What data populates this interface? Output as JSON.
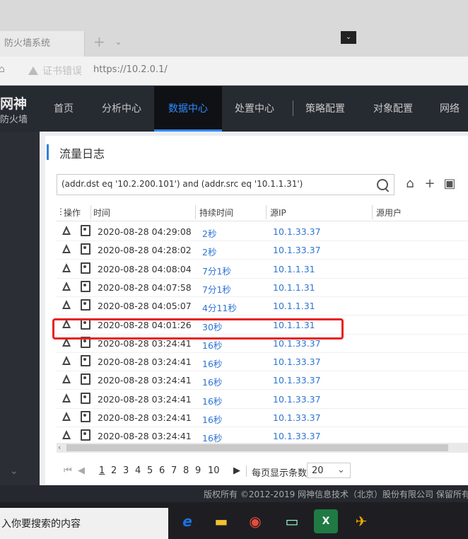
{
  "browser": {
    "tab_title": "防火墙系统",
    "cert_warning": "证书错误",
    "url": "https://10.2.0.1/"
  },
  "app": {
    "logo_line1": "网神",
    "logo_line2": "防火墙",
    "nav": [
      "首页",
      "分析中心",
      "数据中心",
      "处置中心",
      "策略配置",
      "对象配置",
      "网络配"
    ],
    "active_nav": "数据中心"
  },
  "panel": {
    "title": "流量日志",
    "search_query": "(addr.dst eq '10.2.200.101') and (addr.src eq '10.1.1.31')"
  },
  "table": {
    "headers": {
      "op": "操作",
      "time": "时间",
      "duration": "持续时间",
      "src_ip": "源IP",
      "src_user": "源用户"
    },
    "rows": [
      {
        "time": "2020-08-28 04:29:08",
        "duration": "2秒",
        "src_ip": "10.1.33.37"
      },
      {
        "time": "2020-08-28 04:28:02",
        "duration": "2秒",
        "src_ip": "10.1.33.37"
      },
      {
        "time": "2020-08-28 04:08:04",
        "duration": "7分1秒",
        "src_ip": "10.1.1.31"
      },
      {
        "time": "2020-08-28 04:07:58",
        "duration": "7分1秒",
        "src_ip": "10.1.1.31"
      },
      {
        "time": "2020-08-28 04:05:07",
        "duration": "4分11秒",
        "src_ip": "10.1.1.31"
      },
      {
        "time": "2020-08-28 04:01:26",
        "duration": "30秒",
        "src_ip": "10.1.1.31"
      },
      {
        "time": "2020-08-28 03:24:41",
        "duration": "16秒",
        "src_ip": "10.1.33.37"
      },
      {
        "time": "2020-08-28 03:24:41",
        "duration": "16秒",
        "src_ip": "10.1.33.37"
      },
      {
        "time": "2020-08-28 03:24:41",
        "duration": "16秒",
        "src_ip": "10.1.33.37"
      },
      {
        "time": "2020-08-28 03:24:41",
        "duration": "16秒",
        "src_ip": "10.1.33.37"
      },
      {
        "time": "2020-08-28 03:24:41",
        "duration": "16秒",
        "src_ip": "10.1.33.37"
      },
      {
        "time": "2020-08-28 03:24:41",
        "duration": "16秒",
        "src_ip": "10.1.33.37"
      }
    ]
  },
  "pagination": {
    "pages": [
      "1",
      "2",
      "3",
      "4",
      "5",
      "6",
      "7",
      "8",
      "9",
      "10"
    ],
    "current_page": "1",
    "per_page_label": "每页显示条数",
    "per_page_value": "20"
  },
  "footer": {
    "copyright": "版权所有 ©2012-2019 网神信息技术（北京）股份有限公司 保留所有权"
  },
  "taskbar": {
    "search_placeholder": "入你要搜索的内容"
  },
  "colors": {
    "accent": "#2f8bff",
    "link": "#2e74d4",
    "highlight": "#e62020"
  }
}
